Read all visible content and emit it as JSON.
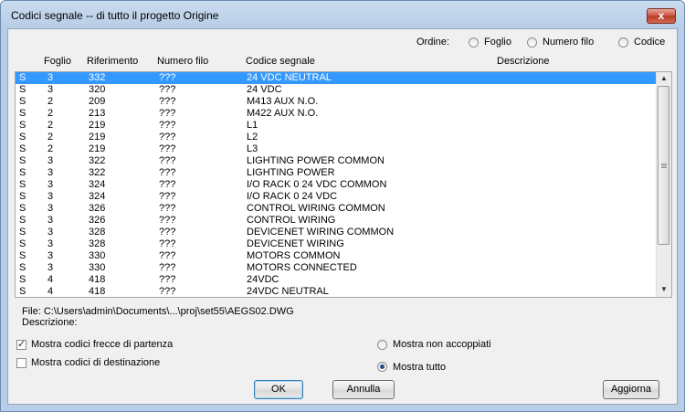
{
  "window": {
    "title": "Codici segnale -- di tutto il progetto Origine",
    "close_glyph": "x"
  },
  "sort": {
    "label": "Ordine:",
    "options": [
      {
        "label": "Foglio",
        "checked": false
      },
      {
        "label": "Numero filo",
        "checked": false
      },
      {
        "label": "Codice",
        "checked": false
      }
    ]
  },
  "columns": {
    "type": "",
    "sheet": "Foglio",
    "ref": "Riferimento",
    "wire": "Numero filo",
    "code": "Codice segnale",
    "desc": "Descrizione"
  },
  "rows": [
    {
      "t": "S",
      "sheet": "3",
      "ref": "332",
      "wire": "???",
      "code": "24 VDC NEUTRAL",
      "selected": true
    },
    {
      "t": "S",
      "sheet": "3",
      "ref": "320",
      "wire": "???",
      "code": "24 VDC"
    },
    {
      "t": "S",
      "sheet": "2",
      "ref": "209",
      "wire": "???",
      "code": "M413 AUX N.O."
    },
    {
      "t": "S",
      "sheet": "2",
      "ref": "213",
      "wire": "???",
      "code": "M422 AUX N.O."
    },
    {
      "t": "S",
      "sheet": "2",
      "ref": "219",
      "wire": "???",
      "code": "L1"
    },
    {
      "t": "S",
      "sheet": "2",
      "ref": "219",
      "wire": "???",
      "code": "L2"
    },
    {
      "t": "S",
      "sheet": "2",
      "ref": "219",
      "wire": "???",
      "code": "L3"
    },
    {
      "t": "S",
      "sheet": "3",
      "ref": "322",
      "wire": "???",
      "code": "LIGHTING POWER COMMON"
    },
    {
      "t": "S",
      "sheet": "3",
      "ref": "322",
      "wire": "???",
      "code": "LIGHTING POWER"
    },
    {
      "t": "S",
      "sheet": "3",
      "ref": "324",
      "wire": "???",
      "code": "I/O RACK 0 24 VDC COMMON"
    },
    {
      "t": "S",
      "sheet": "3",
      "ref": "324",
      "wire": "???",
      "code": "I/O RACK 0 24 VDC"
    },
    {
      "t": "S",
      "sheet": "3",
      "ref": "326",
      "wire": "???",
      "code": "CONTROL WIRING COMMON"
    },
    {
      "t": "S",
      "sheet": "3",
      "ref": "326",
      "wire": "???",
      "code": "CONTROL WIRING"
    },
    {
      "t": "S",
      "sheet": "3",
      "ref": "328",
      "wire": "???",
      "code": "DEVICENET WIRING COMMON"
    },
    {
      "t": "S",
      "sheet": "3",
      "ref": "328",
      "wire": "???",
      "code": "DEVICENET WIRING"
    },
    {
      "t": "S",
      "sheet": "3",
      "ref": "330",
      "wire": "???",
      "code": "MOTORS COMMON"
    },
    {
      "t": "S",
      "sheet": "3",
      "ref": "330",
      "wire": "???",
      "code": "MOTORS CONNECTED"
    },
    {
      "t": "S",
      "sheet": "4",
      "ref": "418",
      "wire": "???",
      "code": "24VDC"
    },
    {
      "t": "S",
      "sheet": "4",
      "ref": "418",
      "wire": "???",
      "code": "24VDC NEUTRAL"
    }
  ],
  "info": {
    "file": "File: C:\\Users\\admin\\Documents\\...\\proj\\set55\\AEGS02.DWG",
    "description": "Descrizione:"
  },
  "options": {
    "show_source": {
      "label": "Mostra codici frecce di partenza",
      "checked": true
    },
    "show_dest": {
      "label": "Mostra codici di destinazione",
      "checked": false
    },
    "show_unpaired": {
      "label": "Mostra non accoppiati",
      "checked": false
    },
    "show_all": {
      "label": "Mostra tutto",
      "checked": true
    }
  },
  "buttons": {
    "ok": "OK",
    "cancel": "Annulla",
    "refresh": "Aggiorna"
  },
  "scrollbar": {
    "up_glyph": "▲",
    "down_glyph": "▼"
  },
  "colors": {
    "selection": "#3399ff",
    "titlebar": "#c9dbef",
    "close": "#c8503c"
  }
}
